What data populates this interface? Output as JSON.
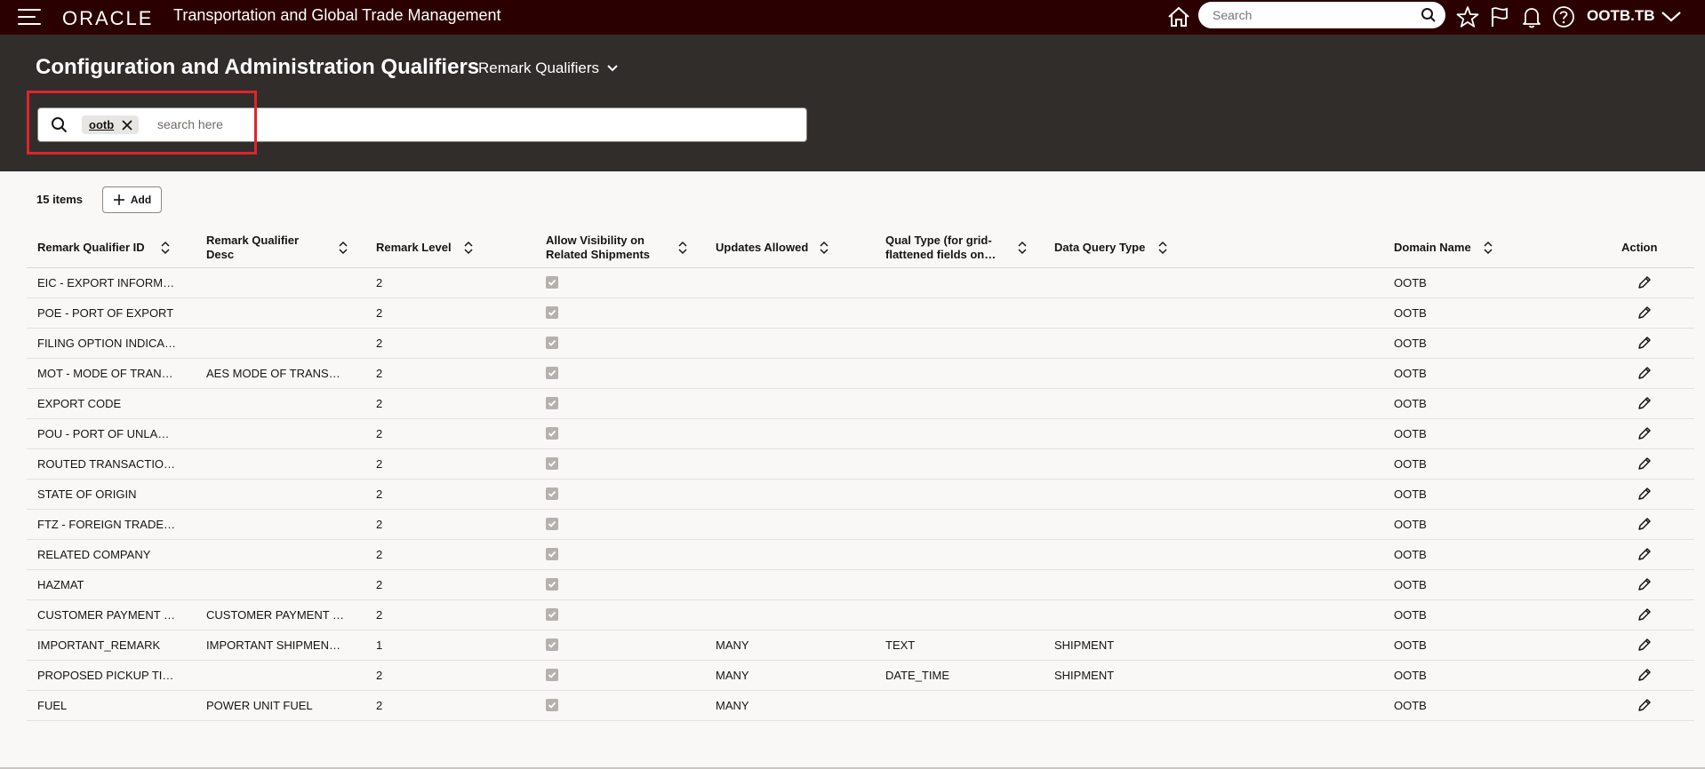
{
  "topbar": {
    "logo": "ORACLE",
    "app_title": "Transportation and Global Trade Management",
    "search_placeholder": "Search",
    "user": "OOTB.TB"
  },
  "header": {
    "title": "Configuration and Administration Qualifiers",
    "qualifier_select": "Remark Qualifiers",
    "filter_chip": "ootb",
    "filter_placeholder": "search here"
  },
  "toolbar": {
    "count": "15 items",
    "add_label": "Add"
  },
  "columns": [
    {
      "label": "Remark Qualifier ID",
      "sortable": true
    },
    {
      "label": "Remark Qualifier Desc",
      "sortable": true
    },
    {
      "label": "Remark Level",
      "sortable": true
    },
    {
      "label": "Allow Visibility on Related Shipments",
      "sortable": true
    },
    {
      "label": "Updates Allowed",
      "sortable": true
    },
    {
      "label": "Qual Type (for grid-flattened fields on…",
      "sortable": true
    },
    {
      "label": "Data Query Type",
      "sortable": true
    },
    {
      "label": "Domain Name",
      "sortable": true
    },
    {
      "label": "Action",
      "sortable": false
    }
  ],
  "rows": [
    {
      "id": "EIC - EXPORT INFORM…",
      "desc": "",
      "level": "2",
      "visibility": true,
      "updates": "",
      "qual_type": "",
      "query_type": "",
      "domain": "OOTB"
    },
    {
      "id": "POE - PORT OF EXPORT",
      "desc": "",
      "level": "2",
      "visibility": true,
      "updates": "",
      "qual_type": "",
      "query_type": "",
      "domain": "OOTB"
    },
    {
      "id": "FILING OPTION INDICA…",
      "desc": "",
      "level": "2",
      "visibility": true,
      "updates": "",
      "qual_type": "",
      "query_type": "",
      "domain": "OOTB"
    },
    {
      "id": "MOT - MODE OF TRAN…",
      "desc": "AES MODE OF TRANS…",
      "level": "2",
      "visibility": true,
      "updates": "",
      "qual_type": "",
      "query_type": "",
      "domain": "OOTB"
    },
    {
      "id": "EXPORT CODE",
      "desc": "",
      "level": "2",
      "visibility": true,
      "updates": "",
      "qual_type": "",
      "query_type": "",
      "domain": "OOTB"
    },
    {
      "id": "POU - PORT OF UNLA…",
      "desc": "",
      "level": "2",
      "visibility": true,
      "updates": "",
      "qual_type": "",
      "query_type": "",
      "domain": "OOTB"
    },
    {
      "id": "ROUTED TRANSACTIO…",
      "desc": "",
      "level": "2",
      "visibility": true,
      "updates": "",
      "qual_type": "",
      "query_type": "",
      "domain": "OOTB"
    },
    {
      "id": "STATE OF ORIGIN",
      "desc": "",
      "level": "2",
      "visibility": true,
      "updates": "",
      "qual_type": "",
      "query_type": "",
      "domain": "OOTB"
    },
    {
      "id": "FTZ - FOREIGN TRADE…",
      "desc": "",
      "level": "2",
      "visibility": true,
      "updates": "",
      "qual_type": "",
      "query_type": "",
      "domain": "OOTB"
    },
    {
      "id": "RELATED COMPANY",
      "desc": "",
      "level": "2",
      "visibility": true,
      "updates": "",
      "qual_type": "",
      "query_type": "",
      "domain": "OOTB"
    },
    {
      "id": "HAZMAT",
      "desc": "",
      "level": "2",
      "visibility": true,
      "updates": "",
      "qual_type": "",
      "query_type": "",
      "domain": "OOTB"
    },
    {
      "id": "CUSTOMER PAYMENT …",
      "desc": "CUSTOMER PAYMENT …",
      "level": "2",
      "visibility": true,
      "updates": "",
      "qual_type": "",
      "query_type": "",
      "domain": "OOTB"
    },
    {
      "id": "IMPORTANT_REMARK",
      "desc": "IMPORTANT SHIPMEN…",
      "level": "1",
      "visibility": true,
      "updates": "MANY",
      "qual_type": "TEXT",
      "query_type": "SHIPMENT",
      "domain": "OOTB"
    },
    {
      "id": "PROPOSED PICKUP TI…",
      "desc": "",
      "level": "2",
      "visibility": true,
      "updates": "MANY",
      "qual_type": "DATE_TIME",
      "query_type": "SHIPMENT",
      "domain": "OOTB"
    },
    {
      "id": "FUEL",
      "desc": "POWER UNIT FUEL",
      "level": "2",
      "visibility": true,
      "updates": "MANY",
      "qual_type": "",
      "query_type": "",
      "domain": "OOTB"
    }
  ]
}
